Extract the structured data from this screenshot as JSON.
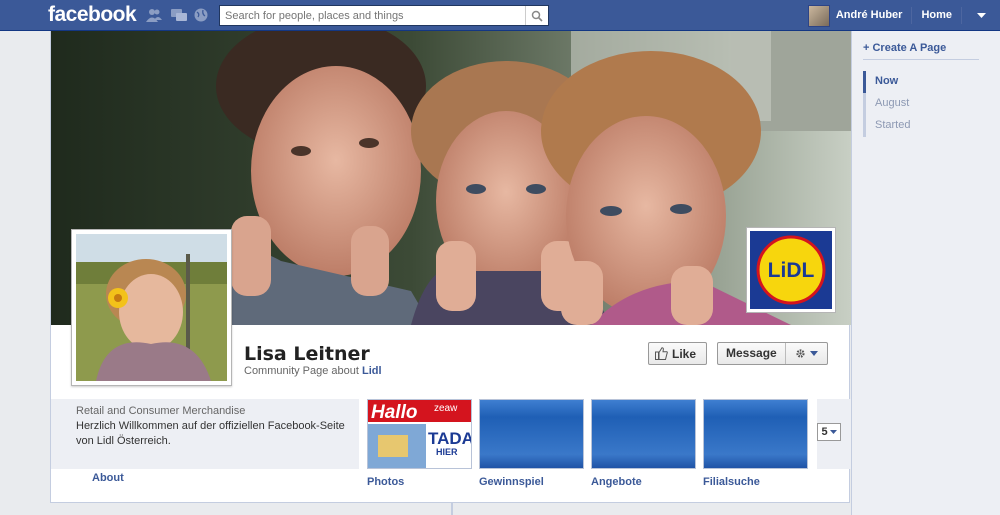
{
  "topbar": {
    "logo": "facebook",
    "search_placeholder": "Search for people, places and things",
    "user_name": "André Huber",
    "home_label": "Home"
  },
  "page": {
    "name": "Lisa Leitner",
    "subtitle_prefix": "Community Page about",
    "subtitle_link": "Lidl",
    "like_label": "Like",
    "message_label": "Message"
  },
  "about": {
    "category": "Retail and Consumer Merchandise",
    "description": "Herzlich Willkommen auf der offiziellen Facebook-Seite von Lidl Österreich.",
    "link_label": "About"
  },
  "apps": [
    {
      "label": "Photos"
    },
    {
      "label": "Gewinnspiel"
    },
    {
      "label": "Angebote"
    },
    {
      "label": "Filialsuche"
    }
  ],
  "photo_thumb": {
    "text_hallo": "Hallo",
    "text_zeaw": "zeaw",
    "text_tada": "TADA",
    "text_hier": "HIER"
  },
  "more_count": "5",
  "logo_text": "LiDL",
  "sidebar": {
    "create_page": "Create A Page",
    "items": [
      {
        "label": "Now",
        "active": true
      },
      {
        "label": "August",
        "active": false
      },
      {
        "label": "Started",
        "active": false
      }
    ]
  },
  "colors": {
    "brand_blue": "#3b5998",
    "background": "#e9ebee",
    "lidl_blue": "#1b3a94",
    "lidl_yellow": "#f7d60d",
    "lidl_red": "#d4141e"
  }
}
